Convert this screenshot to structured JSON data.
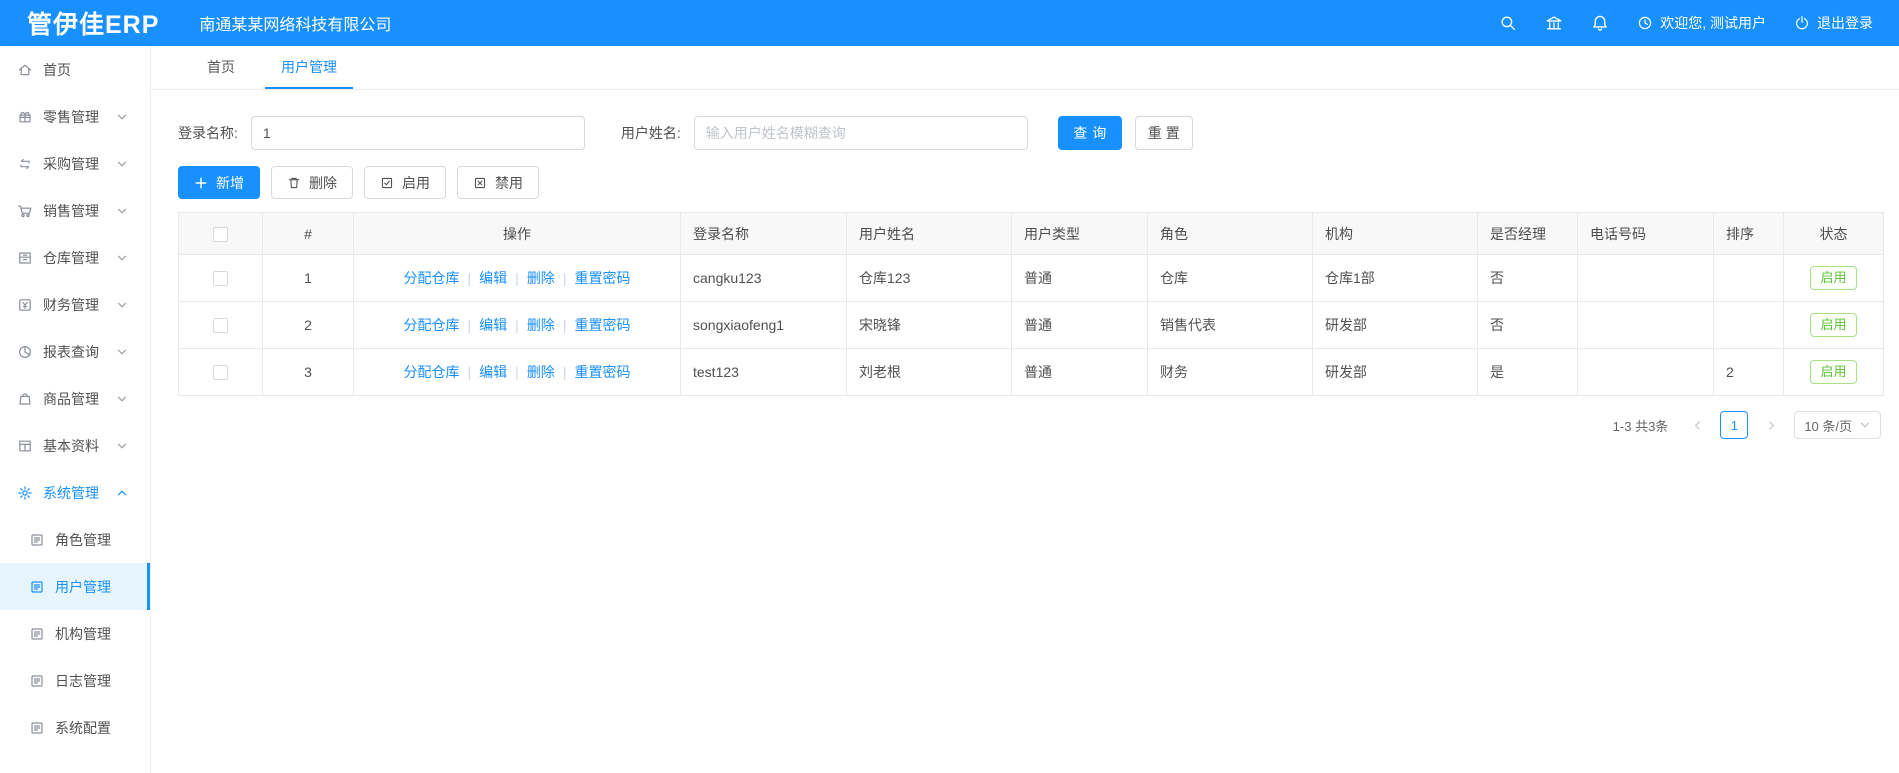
{
  "header": {
    "logo": "管伊佳ERP",
    "company": "南通某某网络科技有限公司",
    "icons": [
      "search-icon",
      "bank-icon",
      "bell-icon"
    ],
    "welcome": "欢迎您, 测试用户",
    "logout": "退出登录"
  },
  "sidebar": {
    "items": [
      {
        "key": "home",
        "label": "首页",
        "icon": "home-icon",
        "expandable": false
      },
      {
        "key": "retail",
        "label": "零售管理",
        "icon": "retail-icon",
        "expandable": true
      },
      {
        "key": "purchase",
        "label": "采购管理",
        "icon": "purchase-icon",
        "expandable": true
      },
      {
        "key": "sales",
        "label": "销售管理",
        "icon": "cart-icon",
        "expandable": true
      },
      {
        "key": "warehouse",
        "label": "仓库管理",
        "icon": "warehouse-icon",
        "expandable": true
      },
      {
        "key": "finance",
        "label": "财务管理",
        "icon": "finance-icon",
        "expandable": true
      },
      {
        "key": "report",
        "label": "报表查询",
        "icon": "pie-chart-icon",
        "expandable": true
      },
      {
        "key": "goods",
        "label": "商品管理",
        "icon": "bag-icon",
        "expandable": true
      },
      {
        "key": "basic-data",
        "label": "基本资料",
        "icon": "grid-icon",
        "expandable": true
      },
      {
        "key": "system",
        "label": "系统管理",
        "icon": "gear-icon",
        "expandable": true,
        "expanded": true,
        "active": true
      }
    ],
    "subitems": [
      {
        "key": "role",
        "label": "角色管理"
      },
      {
        "key": "user",
        "label": "用户管理",
        "active": true
      },
      {
        "key": "org",
        "label": "机构管理"
      },
      {
        "key": "log",
        "label": "日志管理"
      },
      {
        "key": "config",
        "label": "系统配置"
      }
    ]
  },
  "tabs": [
    {
      "key": "home",
      "label": "首页"
    },
    {
      "key": "user-management",
      "label": "用户管理",
      "active": true
    }
  ],
  "search": {
    "login_label": "登录名称:",
    "login_value": "1",
    "name_label": "用户姓名:",
    "name_placeholder": "输入用户姓名模糊查询",
    "query_btn": "查询",
    "reset_btn": "重置"
  },
  "toolbar": {
    "add": "新增",
    "delete": "删除",
    "enable": "启用",
    "disable": "禁用"
  },
  "table": {
    "headers": [
      {
        "key": "index",
        "label": "#",
        "center": true
      },
      {
        "key": "operation",
        "label": "操作",
        "center": true
      },
      {
        "key": "login-name",
        "label": "登录名称",
        "center": false
      },
      {
        "key": "user-name",
        "label": "用户姓名",
        "center": false
      },
      {
        "key": "user-type",
        "label": "用户类型",
        "center": false
      },
      {
        "key": "role",
        "label": "角色",
        "center": false
      },
      {
        "key": "org",
        "label": "机构",
        "center": false
      },
      {
        "key": "is-manager",
        "label": "是否经理",
        "center": false
      },
      {
        "key": "phone",
        "label": "电话号码",
        "center": false
      },
      {
        "key": "sort",
        "label": "排序",
        "center": false
      },
      {
        "key": "status",
        "label": "状态",
        "center": true
      }
    ],
    "op_links": [
      {
        "key": "assign-warehouse-link",
        "label": "分配仓库"
      },
      {
        "key": "edit-link",
        "label": "编辑"
      },
      {
        "key": "delete-link",
        "label": "删除"
      },
      {
        "key": "reset-password-link",
        "label": "重置密码"
      }
    ],
    "op_separator": "|",
    "rows": [
      {
        "index": "1",
        "login": "cangku123",
        "name": "仓库123",
        "type": "普通",
        "role": "仓库",
        "org": "仓库1部",
        "manager": "否",
        "phone": "",
        "sort": "",
        "status": "启用"
      },
      {
        "index": "2",
        "login": "songxiaofeng1",
        "name": "宋晓锋",
        "type": "普通",
        "role": "销售代表",
        "org": "研发部",
        "manager": "否",
        "phone": "",
        "sort": "",
        "status": "启用"
      },
      {
        "index": "3",
        "login": "test123",
        "name": "刘老根",
        "type": "普通",
        "role": "财务",
        "org": "研发部",
        "manager": "是",
        "phone": "",
        "sort": "2",
        "status": "启用"
      }
    ]
  },
  "pagination": {
    "total": "1-3 共3条",
    "page": "1",
    "page_size": "10 条/页"
  },
  "colors": {
    "primary": "#1890ff",
    "status_green_text": "#5fc13a",
    "status_green_border": "#a9e084",
    "active_item_bg": "#e7f5fe"
  }
}
